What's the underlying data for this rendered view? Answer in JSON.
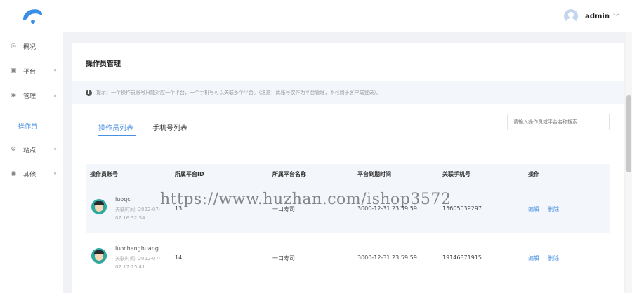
{
  "header": {
    "username": "admin",
    "chevron": "﹀"
  },
  "sidebar": {
    "items": [
      {
        "label": "概况",
        "icon": "◎"
      },
      {
        "label": "平台",
        "icon": "▣",
        "arrow": "∨"
      },
      {
        "label": "管理",
        "icon": "◉",
        "arrow": "∧"
      },
      {
        "label": "站点",
        "icon": "⚙",
        "arrow": "∨"
      },
      {
        "label": "其他",
        "icon": "◉",
        "arrow": "∨"
      }
    ],
    "sub_item": "操作员"
  },
  "page": {
    "title": "操作员管理",
    "tip": "提示：一个操作员账号只能对应一个平台，一个手机号可以关联多个平台。（注意：此账号仅作为平台管理，不可用于客户端登录）。"
  },
  "tabs": [
    {
      "label": "操作员列表"
    },
    {
      "label": "手机号列表"
    }
  ],
  "search": {
    "placeholder": "请输入操作员或平台名称搜索"
  },
  "table": {
    "headers": [
      "操作员账号",
      "所属平台ID",
      "所属平台名称",
      "平台到期时间",
      "关联手机号",
      "操作"
    ],
    "rows": [
      {
        "account": "luoqc",
        "link_time_label": "关联时间: 2022-07-",
        "link_time_rest": "07 16:32:54",
        "platform_id": "13",
        "platform_name": "一口寿司",
        "expire": "3000-12-31 23:59:59",
        "phone": "15605039297",
        "edit": "编辑",
        "delete": "删除"
      },
      {
        "account": "luochenghuang",
        "link_time_label": "关联时间: 2022-07-",
        "link_time_rest": "07 17:25:41",
        "platform_id": "14",
        "platform_name": "一口寿司",
        "expire": "3000-12-31 23:59:59",
        "phone": "19146871915",
        "edit": "编辑",
        "delete": "删除"
      }
    ]
  },
  "watermark": "https://www.huzhan.com/ishop3572",
  "colors": {
    "accent": "#4a90e2",
    "avatar_bg": "#2ea8a0"
  }
}
